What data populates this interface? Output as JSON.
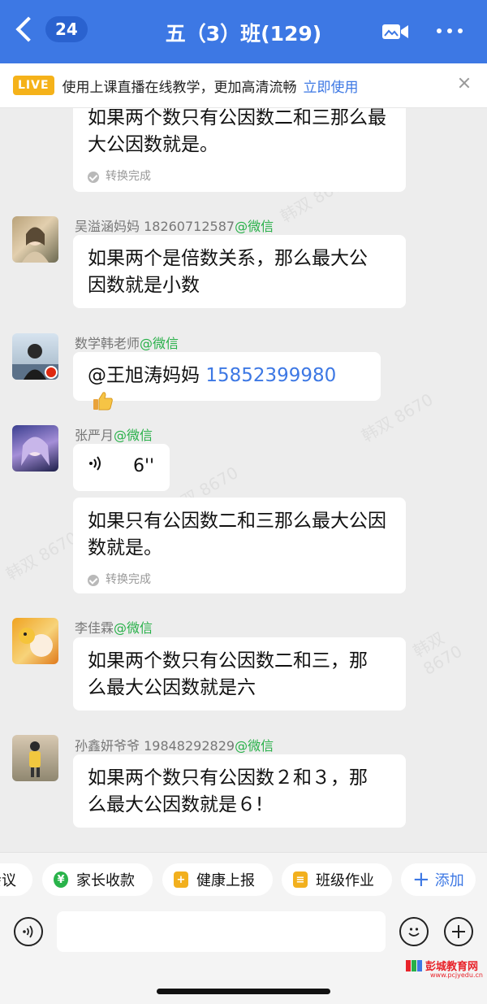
{
  "header": {
    "back_count": "24",
    "title": "五（3）班(129)"
  },
  "live_banner": {
    "tag": "LIVE",
    "text": "使用上课直播在线教学，更加高清流畅",
    "action": "立即使用"
  },
  "messages": [
    {
      "text_line1": "如果两个数只有公因数二和三那么最",
      "text_line2": "大公因数就是。",
      "status": "转换完成"
    },
    {
      "sender": "吴溢涵妈妈 18260712587",
      "source": "@微信",
      "text_line1": "如果两个是倍数关系，那么最大公",
      "text_line2": "因数就是小数"
    },
    {
      "sender": "数学韩老师",
      "source": "@微信",
      "mention": "@王旭涛妈妈",
      "phone": "15852399980"
    },
    {
      "sender": "张严月",
      "source": "@微信",
      "voice_duration": "6''",
      "text_line1": "如果只有公因数二和三那么最大公因",
      "text_line2": "数就是。",
      "status": "转换完成"
    },
    {
      "sender": "李佳霖",
      "source": "@微信",
      "text_line1": "如果两个数只有公因数二和三，那",
      "text_line2": "么最大公因数就是六"
    },
    {
      "sender": "孙鑫妍爷爷 19848292829",
      "source": "@微信",
      "text_line1": "如果两个数只有公因数２和３，那",
      "text_line2": "么最大公因数就是６!"
    }
  ],
  "quick_actions": {
    "meeting": "会议",
    "fee": "家长收款",
    "health": "健康上报",
    "homework": "班级作业",
    "add": "添加"
  },
  "watermark": "韩双 8670",
  "site_logo": {
    "name": "彭城教育网",
    "url": "www.pcjyedu.cn"
  },
  "colors": {
    "header": "#3d78e4",
    "wechat_green": "#27b048",
    "link_blue": "#3d78e4",
    "live_orange": "#f5b21a"
  }
}
